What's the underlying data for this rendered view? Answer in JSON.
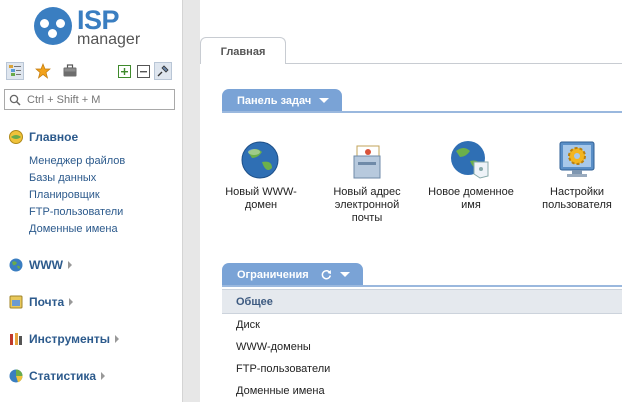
{
  "logo": {
    "brand": "ISP",
    "product": "manager"
  },
  "toolbar": {
    "icons": [
      "tree-view-icon",
      "favorites-star-icon",
      "briefcase-icon",
      "expand-all-icon",
      "collapse-all-icon",
      "pin-icon"
    ]
  },
  "search": {
    "placeholder": "Ctrl + Shift + M",
    "value": ""
  },
  "sidebar": {
    "main": {
      "label": "Главное",
      "items": [
        "Менеджер файлов",
        "Базы данных",
        "Планировщик",
        "FTP-пользователи",
        "Доменные имена"
      ]
    },
    "sections": [
      {
        "label": "WWW",
        "icon": "globe-icon"
      },
      {
        "label": "Почта",
        "icon": "mail-icon"
      },
      {
        "label": "Инструменты",
        "icon": "tools-icon"
      },
      {
        "label": "Статистика",
        "icon": "statistics-icon"
      }
    ]
  },
  "tabs": [
    {
      "label": "Главная"
    }
  ],
  "taskbar": {
    "title": "Панель задач",
    "tasks": [
      {
        "label": "Новый WWW-домен",
        "icon": "globe-new-icon"
      },
      {
        "label": "Новый адрес электронной почты",
        "icon": "mailbox-icon"
      },
      {
        "label": "Новое доменное имя",
        "icon": "domain-name-icon"
      },
      {
        "label": "Настройки пользователя",
        "icon": "user-settings-icon"
      }
    ]
  },
  "limits": {
    "title": "Ограничения",
    "header": "Общее",
    "rows": [
      "Диск",
      "WWW-домены",
      "FTP-пользователи",
      "Доменные имена"
    ]
  },
  "colors": {
    "accent": "#7aa3d6",
    "link": "#2c5a8c",
    "brand": "#3a7ec1"
  }
}
